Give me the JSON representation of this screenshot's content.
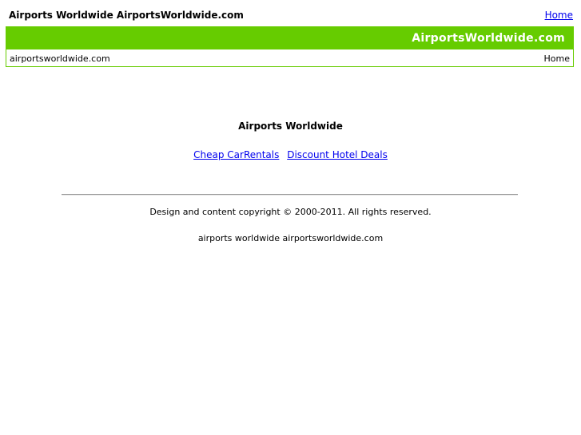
{
  "header": {
    "site_title": "Airports Worldwide AirportsWorldwide.com",
    "home_link": "Home"
  },
  "banner": {
    "brand": "AirportsWorldwide.com"
  },
  "subbar": {
    "domain": "airportsworldwide.com",
    "home": "Home"
  },
  "main": {
    "heading": "Airports Worldwide",
    "links": [
      "Cheap CarRentals",
      "Discount Hotel Deals"
    ]
  },
  "footer": {
    "copyright": "Design and content copyright © 2000-2011. All rights reserved.",
    "tagline": "airports worldwide airportsworldwide.com"
  },
  "colors": {
    "accent": "#66cc00",
    "link": "#0000ee"
  }
}
